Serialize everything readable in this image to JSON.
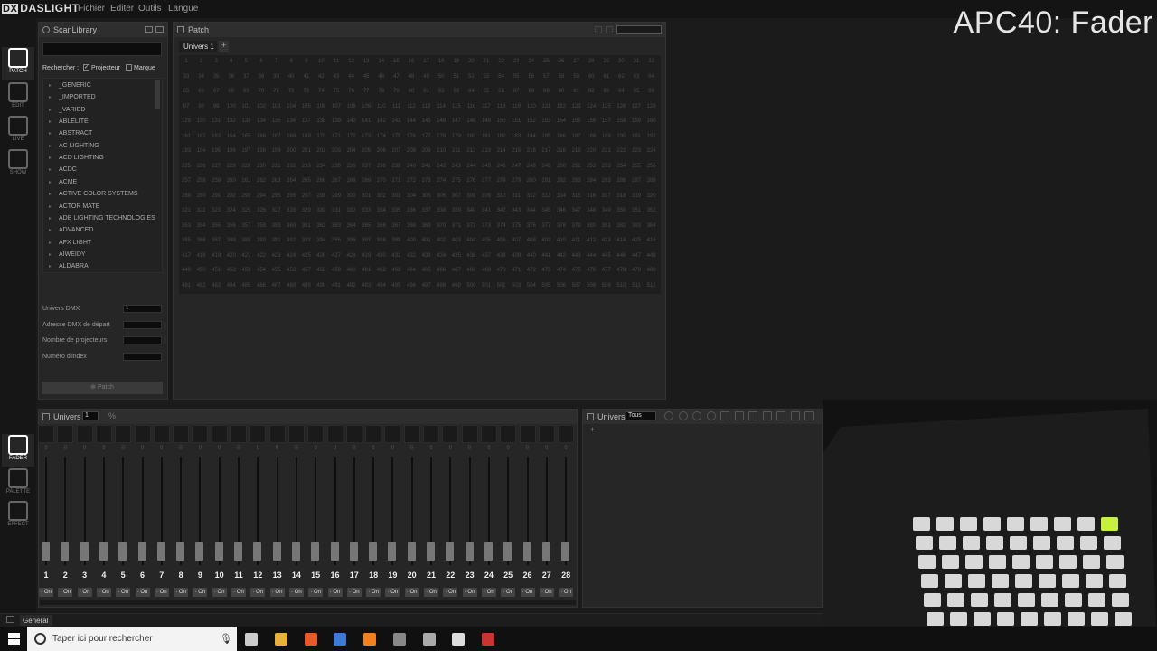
{
  "app": {
    "logo": "DASLIGHT",
    "menu": [
      "Fichier",
      "Editer",
      "Outils",
      "Langue"
    ],
    "overlay_title": "APC40: Fader"
  },
  "nav": {
    "top": [
      {
        "label": "PATCH",
        "icon": "patch-icon",
        "active": true
      },
      {
        "label": "EDIT",
        "icon": "edit-icon",
        "active": false
      },
      {
        "label": "LIVE",
        "icon": "live-icon",
        "active": false
      },
      {
        "label": "SHOW",
        "icon": "show-icon",
        "active": false
      }
    ],
    "bottom": [
      {
        "label": "FADER",
        "icon": "fader-icon",
        "active": true
      },
      {
        "label": "PALETTE",
        "icon": "palette-icon",
        "active": false
      },
      {
        "label": "EFFECT",
        "icon": "effect-icon",
        "active": false
      }
    ]
  },
  "scanlibrary": {
    "title": "ScanLibrary",
    "search_label": "Rechercher :",
    "check_projecteur": "Projecteur",
    "check_marque": "Marque",
    "items": [
      "_GENERIC",
      "_IMPORTED",
      "_VARIED",
      "ABLELITE",
      "ABSTRACT",
      "AC LIGHTING",
      "ACD LIGHTING",
      "ACDC",
      "ACME",
      "ACTIVE COLOR SYSTEMS",
      "ACTOR MATE",
      "ADB LIGHTING TECHNOLOGIES",
      "ADVANCED",
      "AFX LIGHT",
      "AIWEIDY",
      "ALDABRA"
    ],
    "fields": [
      "Univers DMX",
      "Adresse DMX de départ",
      "Nombre de projecteurs",
      "Numéro d'index"
    ],
    "field_values": [
      "1",
      "",
      "",
      ""
    ],
    "patch_button": "Patch"
  },
  "patch": {
    "title": "Patch",
    "tab": "Univers 1",
    "add_tab": "+",
    "channels": 512,
    "per_row": 32
  },
  "fader": {
    "title": "Univers",
    "universe_value": "1",
    "count": 28,
    "value": "0",
    "on_label": "On"
  },
  "univers_panel": {
    "title": "Univers",
    "select": "Tous",
    "add": "+"
  },
  "statusbar": {
    "tab": "Général"
  },
  "taskbar": {
    "search_placeholder": "Taper ici pour rechercher"
  }
}
